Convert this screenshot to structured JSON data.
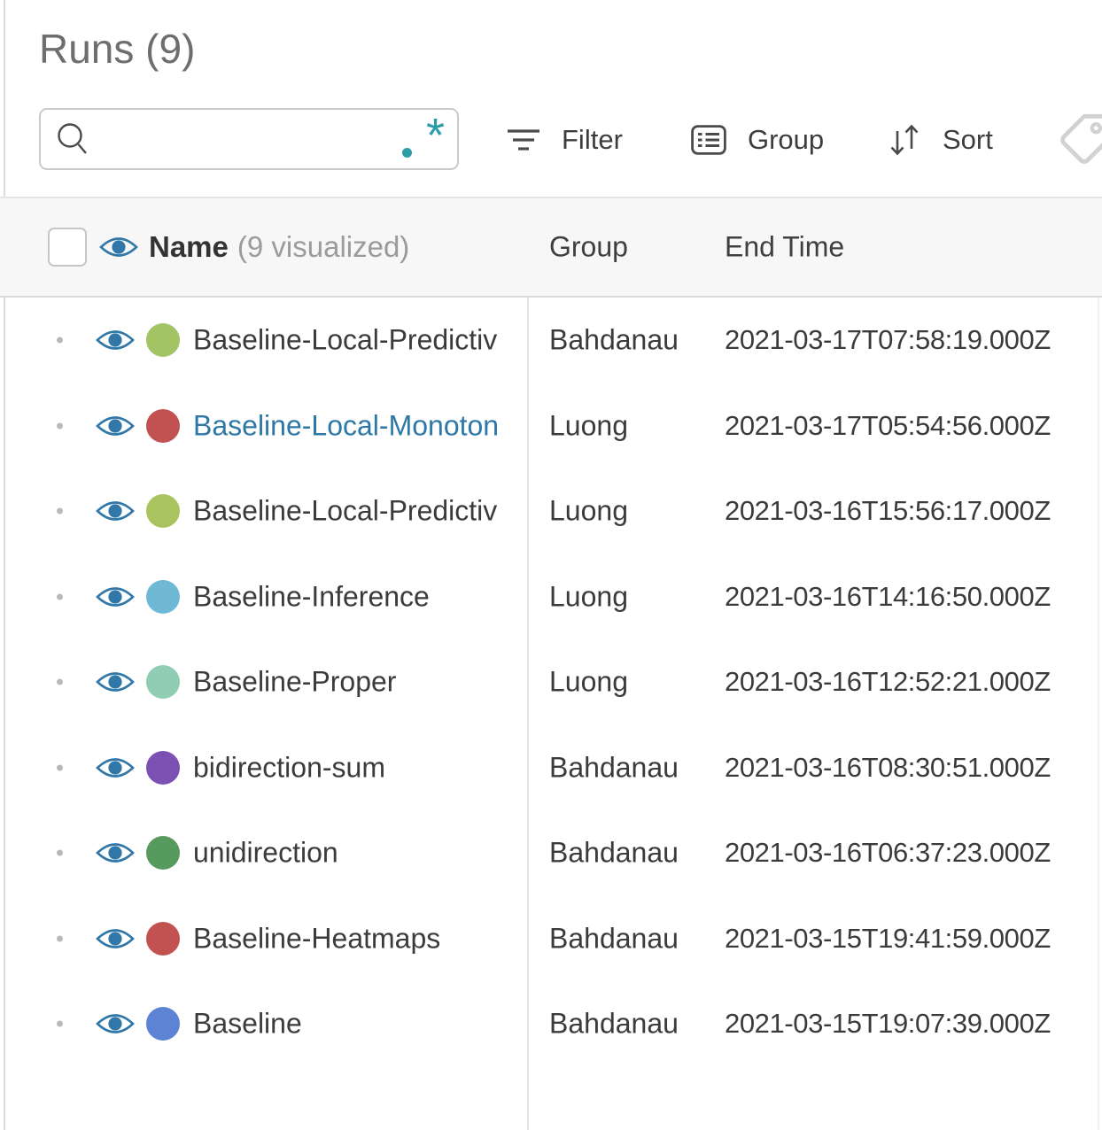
{
  "panel": {
    "title": "Runs (9)"
  },
  "search": {
    "value": "",
    "placeholder": ""
  },
  "toolbar": {
    "filter_label": "Filter",
    "group_label": "Group",
    "sort_label": "Sort"
  },
  "icons": {
    "search": "search-icon",
    "regex": "regex-toggle-icon",
    "filter": "filter-funnel-icon",
    "group": "group-list-icon",
    "sort": "sort-arrows-icon",
    "tag": "tag-icon",
    "visibility": "eye-icon",
    "row_handle": "drag-handle-dot"
  },
  "table": {
    "header": {
      "name_label": "Name",
      "name_annotation": "(9 visualized)",
      "group_label": "Group",
      "end_time_label": "End Time"
    },
    "rows": [
      {
        "name": "Baseline-Local-Predictiv",
        "dot_color": "#a3c464",
        "group": "Bahdanau",
        "end_time": "2021-03-17T07:58:19.000Z",
        "name_is_link": false
      },
      {
        "name": "Baseline-Local-Monoton",
        "dot_color": "#c25252",
        "group": "Luong",
        "end_time": "2021-03-17T05:54:56.000Z",
        "name_is_link": true
      },
      {
        "name": "Baseline-Local-Predictiv",
        "dot_color": "#a9c45e",
        "group": "Luong",
        "end_time": "2021-03-16T15:56:17.000Z",
        "name_is_link": false
      },
      {
        "name": "Baseline-Inference",
        "dot_color": "#6fb9d7",
        "group": "Luong",
        "end_time": "2021-03-16T14:16:50.000Z",
        "name_is_link": false
      },
      {
        "name": "Baseline-Proper",
        "dot_color": "#90cdb4",
        "group": "Luong",
        "end_time": "2021-03-16T12:52:21.000Z",
        "name_is_link": false
      },
      {
        "name": "bidirection-sum",
        "dot_color": "#7d50b4",
        "group": "Bahdanau",
        "end_time": "2021-03-16T08:30:51.000Z",
        "name_is_link": false
      },
      {
        "name": "unidirection",
        "dot_color": "#579a5d",
        "group": "Bahdanau",
        "end_time": "2021-03-16T06:37:23.000Z",
        "name_is_link": false
      },
      {
        "name": "Baseline-Heatmaps",
        "dot_color": "#c25252",
        "group": "Bahdanau",
        "end_time": "2021-03-15T19:41:59.000Z",
        "name_is_link": false
      },
      {
        "name": "Baseline",
        "dot_color": "#5d83d5",
        "group": "Bahdanau",
        "end_time": "2021-03-15T19:07:39.000Z",
        "name_is_link": false
      }
    ]
  },
  "colors": {
    "accent_strip": "#3878a6",
    "eye_icon": "#3178a9",
    "link_text": "#2e78a8",
    "regex_icon": "#2d9ca9"
  }
}
